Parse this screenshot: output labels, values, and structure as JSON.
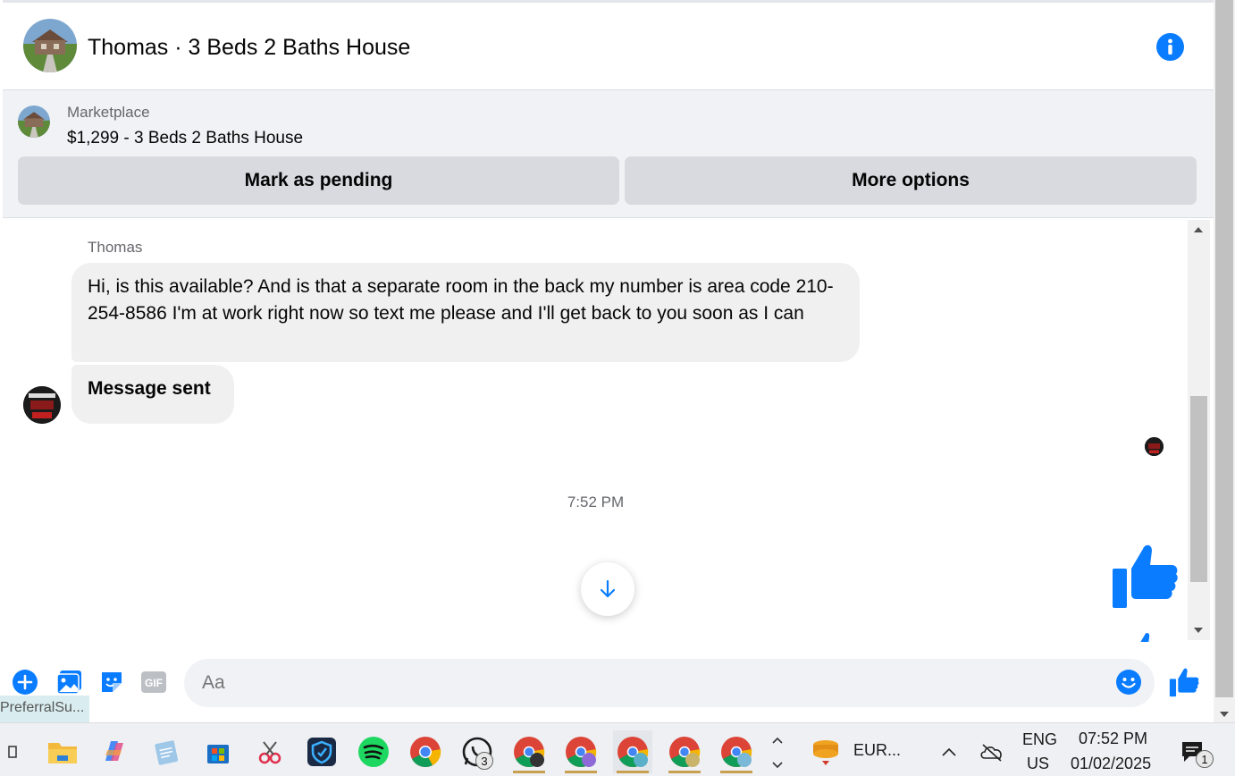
{
  "header": {
    "title": "Thomas · 3 Beds 2 Baths House",
    "info_icon": "info-icon"
  },
  "marketplace": {
    "label": "Marketplace",
    "item": "$1,299 - 3 Beds 2 Baths House",
    "mark_pending": "Mark as pending",
    "more_options": "More options"
  },
  "messages": {
    "sender": "Thomas",
    "message_1": "Hi, is this available? And is that a separate room in the back my number is area code 210-254-8586 I'm at work right now so text me please and I'll get back to you soon as I can",
    "message_2": "Message sent",
    "timestamp": "7:52 PM"
  },
  "composer": {
    "placeholder": "Aa",
    "gif_label": "GIF"
  },
  "tooltip": "PreferralSu...",
  "taskbar": {
    "whatsapp_badge": "3",
    "tray_app_label": "EUR...",
    "language": "ENG",
    "region": "US",
    "time": "07:52 PM",
    "date": "01/02/2025",
    "notification_count": "1"
  },
  "colors": {
    "accent": "#0a7cff",
    "bubble": "#f0f0f0",
    "card_bg": "#f0f2f5",
    "button_bg": "#d8dadf"
  }
}
